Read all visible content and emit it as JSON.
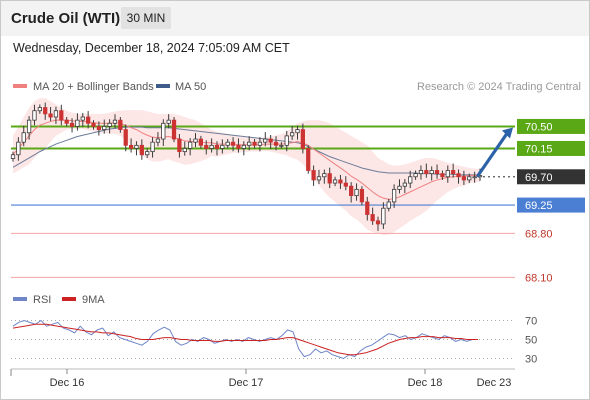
{
  "header": {
    "title": "Crude Oil (WTI)",
    "timeframe": "30 MIN",
    "datetime": "Wednesday, December 18, 2024 7:05:09 AM CET"
  },
  "legend": {
    "ma20": "MA 20 + Bollinger Bands",
    "ma50": "MA 50",
    "attribution": "Research © 2024 Trading Central",
    "rsi": "RSI",
    "ma9": "9MA"
  },
  "colors": {
    "candle": "#cc3333",
    "ma20": "#f08080",
    "ma50": "#6b7c99",
    "band_fill": "#fde6e6",
    "resistance": "#5aa816",
    "current": "#333333",
    "pivot": "#4a7fd4",
    "support": "#f4a3a3",
    "support_text": "#c0392b",
    "arrow": "#2b62a8",
    "rsi_line": "#6f86c9",
    "ma9_line": "#cc2222"
  },
  "chart_data": [
    {
      "type": "candlestick",
      "title": "Crude Oil (WTI)",
      "timeframe": "30 MIN",
      "x_tick_labels": [
        "Dec 16",
        "Dec 17",
        "Dec 18",
        "Dec 23"
      ],
      "ylim": [
        67.9,
        71.0
      ],
      "indicators": [
        "MA 20 + Bollinger Bands",
        "MA 50"
      ],
      "levels": [
        {
          "label": "70.50",
          "value": 70.5,
          "kind": "resistance"
        },
        {
          "label": "70.15",
          "value": 70.15,
          "kind": "resistance"
        },
        {
          "label": "69.70",
          "value": 69.7,
          "kind": "current"
        },
        {
          "label": "69.25",
          "value": 69.25,
          "kind": "pivot"
        },
        {
          "label": "68.80",
          "value": 68.8,
          "kind": "support"
        },
        {
          "label": "68.10",
          "value": 68.1,
          "kind": "support"
        }
      ],
      "close": [
        70.05,
        70.25,
        70.4,
        70.6,
        70.75,
        70.8,
        70.7,
        70.65,
        70.75,
        70.6,
        70.55,
        70.5,
        70.6,
        70.65,
        70.55,
        70.5,
        70.45,
        70.5,
        70.55,
        70.6,
        70.45,
        70.2,
        70.15,
        70.2,
        70.05,
        70.1,
        70.25,
        70.3,
        70.55,
        70.6,
        70.3,
        70.1,
        70.15,
        70.25,
        70.3,
        70.2,
        70.15,
        70.2,
        70.15,
        70.2,
        70.25,
        70.2,
        70.15,
        70.2,
        70.25,
        70.2,
        70.25,
        70.3,
        70.25,
        70.2,
        70.2,
        70.35,
        70.4,
        70.45,
        70.15,
        69.8,
        69.65,
        69.7,
        69.75,
        69.6,
        69.65,
        69.6,
        69.55,
        69.4,
        69.5,
        69.3,
        69.1,
        69.0,
        68.95,
        69.2,
        69.3,
        69.5,
        69.55,
        69.6,
        69.7,
        69.75,
        69.8,
        69.75,
        69.8,
        69.75,
        69.7,
        69.8,
        69.75,
        69.7,
        69.65,
        69.7,
        69.7,
        69.72
      ],
      "ma20": [
        70.05,
        70.15,
        70.25,
        70.35,
        70.45,
        70.52,
        70.55,
        70.58,
        70.6,
        70.6,
        70.6,
        70.59,
        70.58,
        70.58,
        70.57,
        70.56,
        70.55,
        70.55,
        70.55,
        70.56,
        70.55,
        70.52,
        70.48,
        70.45,
        70.4,
        70.36,
        70.33,
        70.32,
        70.33,
        70.34,
        70.32,
        70.3,
        70.27,
        70.26,
        70.26,
        70.25,
        70.24,
        70.24,
        70.22,
        70.22,
        70.22,
        70.22,
        70.21,
        70.21,
        70.21,
        70.21,
        70.21,
        70.22,
        70.22,
        70.22,
        70.22,
        70.23,
        70.24,
        70.26,
        70.24,
        70.2,
        70.14,
        70.08,
        70.02,
        69.96,
        69.9,
        69.84,
        69.78,
        69.71,
        69.66,
        69.6,
        69.53,
        69.46,
        69.4,
        69.36,
        69.34,
        69.35,
        69.38,
        69.42,
        69.46,
        69.5,
        69.54,
        69.58,
        69.62,
        69.65,
        69.67,
        69.69,
        69.7,
        69.71,
        69.71,
        69.72,
        69.72,
        69.72
      ],
      "bb_upper": [
        70.35,
        70.5,
        70.65,
        70.8,
        70.9,
        70.95,
        70.95,
        70.9,
        70.85,
        70.8,
        70.75,
        70.72,
        70.7,
        70.7,
        70.7,
        70.7,
        70.7,
        70.7,
        70.72,
        70.74,
        70.75,
        70.76,
        70.76,
        70.76,
        70.76,
        70.74,
        70.72,
        70.7,
        70.7,
        70.7,
        70.7,
        70.68,
        70.65,
        70.62,
        70.6,
        70.55,
        70.5,
        70.45,
        70.42,
        70.4,
        70.38,
        70.36,
        70.34,
        70.33,
        70.32,
        70.32,
        70.32,
        70.33,
        70.34,
        70.36,
        70.38,
        70.42,
        70.48,
        70.55,
        70.58,
        70.6,
        70.6,
        70.6,
        70.58,
        70.55,
        70.5,
        70.45,
        70.4,
        70.35,
        70.3,
        70.25,
        70.2,
        70.1,
        70.0,
        69.95,
        69.9,
        69.88,
        69.88,
        69.9,
        69.92,
        69.95,
        69.98,
        70.0,
        70.0,
        69.98,
        69.95,
        69.92,
        69.9,
        69.88,
        69.86,
        69.84,
        69.83,
        69.82
      ],
      "bb_lower": [
        69.75,
        69.8,
        69.85,
        69.9,
        70.0,
        70.1,
        70.15,
        70.26,
        70.35,
        70.4,
        70.45,
        70.46,
        70.46,
        70.46,
        70.44,
        70.42,
        70.4,
        70.4,
        70.38,
        70.38,
        70.35,
        70.28,
        70.2,
        70.14,
        70.04,
        69.98,
        69.94,
        69.94,
        69.96,
        69.98,
        69.94,
        69.92,
        69.89,
        69.9,
        69.92,
        69.95,
        69.98,
        70.03,
        70.02,
        70.04,
        70.06,
        70.08,
        70.08,
        70.09,
        70.1,
        70.1,
        70.1,
        70.11,
        70.1,
        70.08,
        70.06,
        70.04,
        70.0,
        69.97,
        69.9,
        69.8,
        69.68,
        69.56,
        69.46,
        69.37,
        69.3,
        69.23,
        69.16,
        69.07,
        69.02,
        68.95,
        68.86,
        68.82,
        68.8,
        68.77,
        68.78,
        68.82,
        68.88,
        68.94,
        69.0,
        69.05,
        69.1,
        69.16,
        69.24,
        69.32,
        69.39,
        69.46,
        69.5,
        69.54,
        69.56,
        69.6,
        69.61,
        69.62
      ],
      "ma50": [
        69.85,
        69.9,
        69.95,
        70.0,
        70.05,
        70.1,
        70.14,
        70.18,
        70.22,
        70.25,
        70.28,
        70.31,
        70.34,
        70.36,
        70.38,
        70.4,
        70.42,
        70.44,
        70.46,
        70.47,
        70.48,
        70.49,
        70.49,
        70.49,
        70.49,
        70.48,
        70.48,
        70.48,
        70.48,
        70.48,
        70.47,
        70.46,
        70.45,
        70.44,
        70.43,
        70.42,
        70.41,
        70.4,
        70.39,
        70.38,
        70.37,
        70.36,
        70.35,
        70.34,
        70.33,
        70.32,
        70.31,
        70.3,
        70.29,
        70.28,
        70.27,
        70.26,
        70.25,
        70.24,
        70.22,
        70.18,
        70.14,
        70.1,
        70.06,
        70.02,
        69.99,
        69.96,
        69.93,
        69.9,
        69.87,
        69.84,
        69.82,
        69.8,
        69.78,
        69.77,
        69.76,
        69.76,
        69.76,
        69.76,
        69.76,
        69.76,
        69.75,
        69.75,
        69.75,
        69.74,
        69.74,
        69.74,
        69.74,
        69.73,
        69.73,
        69.73,
        69.73,
        69.73
      ]
    },
    {
      "type": "line",
      "title": "RSI",
      "series": [
        {
          "name": "RSI",
          "values": [
            64,
            68,
            70,
            68,
            66,
            70,
            64,
            66,
            68,
            62,
            60,
            57,
            64,
            58,
            55,
            60,
            62,
            54,
            58,
            52,
            50,
            48,
            46,
            44,
            48,
            56,
            60,
            63,
            60,
            48,
            44,
            46,
            50,
            48,
            52,
            50,
            46,
            48,
            50,
            48,
            50,
            48,
            52,
            50,
            48,
            50,
            52,
            50,
            54,
            60,
            58,
            40,
            32,
            34,
            40,
            36,
            38,
            34,
            32,
            30,
            34,
            32,
            38,
            42,
            44,
            48,
            52,
            56,
            55,
            52,
            54,
            50,
            52,
            56,
            54,
            52,
            50,
            54,
            52,
            48,
            50,
            48,
            50,
            50
          ]
        },
        {
          "name": "9MA",
          "values": [
            62,
            63,
            64,
            65,
            66,
            66,
            66,
            65,
            64,
            63,
            62,
            61,
            60,
            59,
            58,
            58,
            57,
            57,
            56,
            55,
            54,
            53,
            51,
            50,
            50,
            50,
            51,
            52,
            52,
            51,
            50,
            50,
            49,
            49,
            49,
            49,
            48,
            48,
            49,
            49,
            49,
            49,
            49,
            49,
            49,
            49,
            50,
            50,
            51,
            52,
            52,
            50,
            48,
            46,
            44,
            42,
            40,
            38,
            36,
            35,
            34,
            34,
            35,
            36,
            38,
            40,
            43,
            46,
            48,
            50,
            51,
            52,
            52,
            53,
            53,
            53,
            52,
            52,
            52,
            51,
            51,
            50,
            50,
            50
          ]
        }
      ],
      "ylim": [
        20,
        80
      ],
      "ytick_labels": [
        "70",
        "50",
        "30"
      ]
    }
  ]
}
